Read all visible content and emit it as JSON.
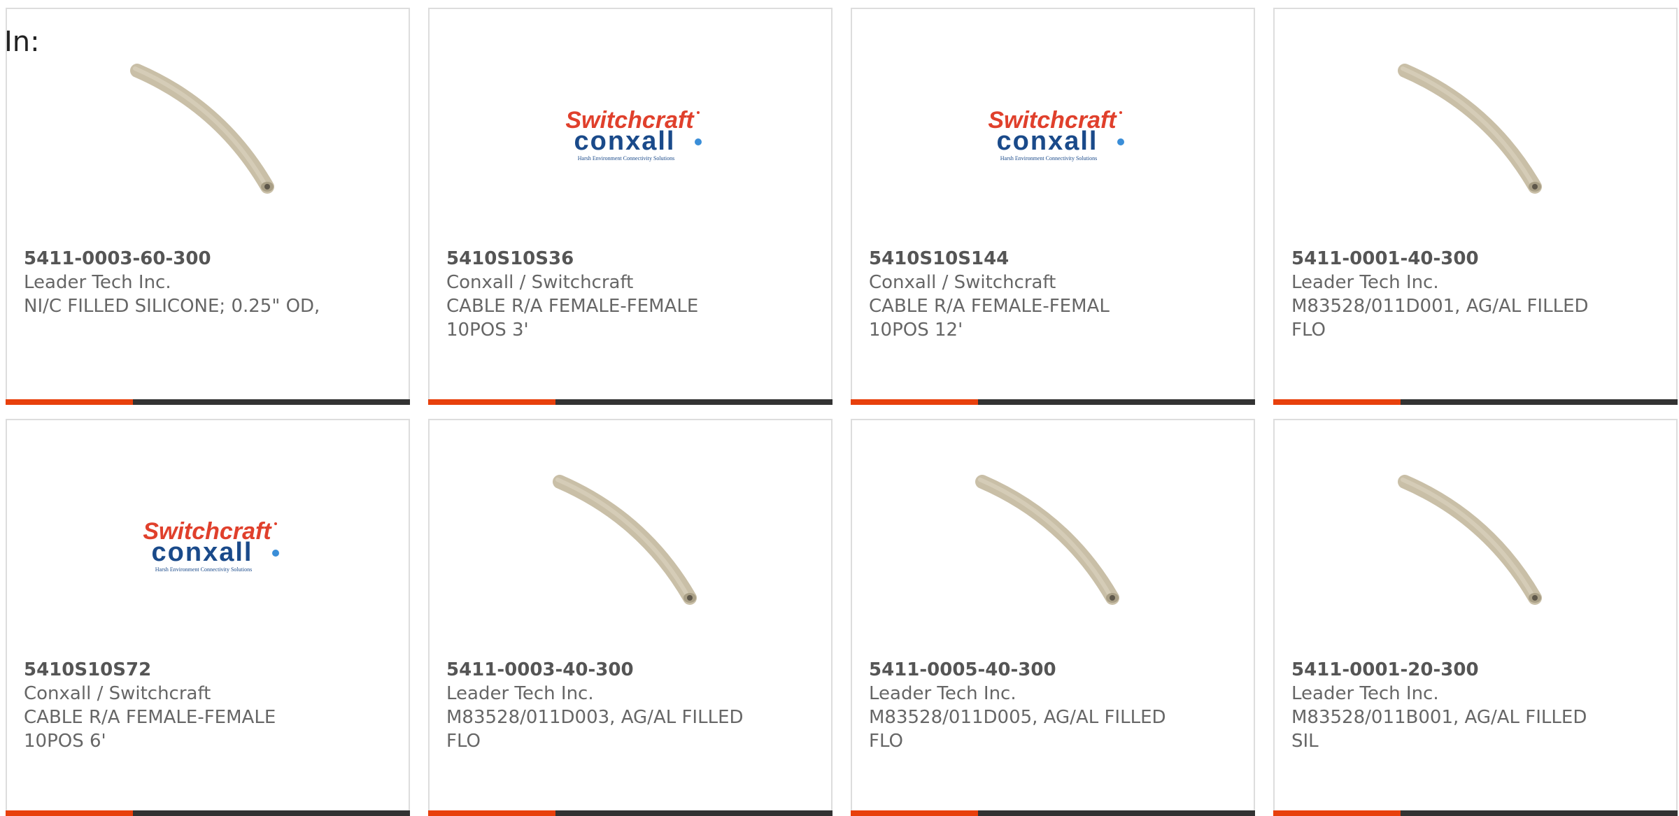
{
  "header": {
    "label": "In:"
  },
  "colors": {
    "accent": "#e8400c",
    "bar": "#333333",
    "tube": "#c9bfa7"
  },
  "products": [
    {
      "part_number": "5411-0003-60-300",
      "manufacturer": "Leader Tech Inc.",
      "description": "NI/C FILLED SILICONE; 0.25\" OD,",
      "image": "tube"
    },
    {
      "part_number": "5410S10S36",
      "manufacturer": "Conxall / Switchcraft",
      "description": "CABLE R/A FEMALE-FEMALE 10POS 3'",
      "image": "logo"
    },
    {
      "part_number": "5410S10S144",
      "manufacturer": "Conxall / Switchcraft",
      "description": "CABLE R/A FEMALE-FEMAL 10POS 12'",
      "image": "logo"
    },
    {
      "part_number": "5411-0001-40-300",
      "manufacturer": "Leader Tech Inc.",
      "description": "M83528/011D001, AG/AL FILLED FLO",
      "image": "tube"
    },
    {
      "part_number": "5410S10S72",
      "manufacturer": "Conxall / Switchcraft",
      "description": "CABLE R/A FEMALE-FEMALE 10POS 6'",
      "image": "logo"
    },
    {
      "part_number": "5411-0003-40-300",
      "manufacturer": "Leader Tech Inc.",
      "description": "M83528/011D003, AG/AL FILLED FLO",
      "image": "tube"
    },
    {
      "part_number": "5411-0005-40-300",
      "manufacturer": "Leader Tech Inc.",
      "description": "M83528/011D005, AG/AL FILLED FLO",
      "image": "tube"
    },
    {
      "part_number": "5411-0001-20-300",
      "manufacturer": "Leader Tech Inc.",
      "description": "M83528/011B001, AG/AL FILLED SIL",
      "image": "tube"
    }
  ],
  "logo": {
    "line1": "Switchcraft",
    "line2": "conxall",
    "tagline": "Harsh Environment Connectivity Solutions",
    "red": "#e0402c",
    "blue": "#1a4a8a"
  }
}
